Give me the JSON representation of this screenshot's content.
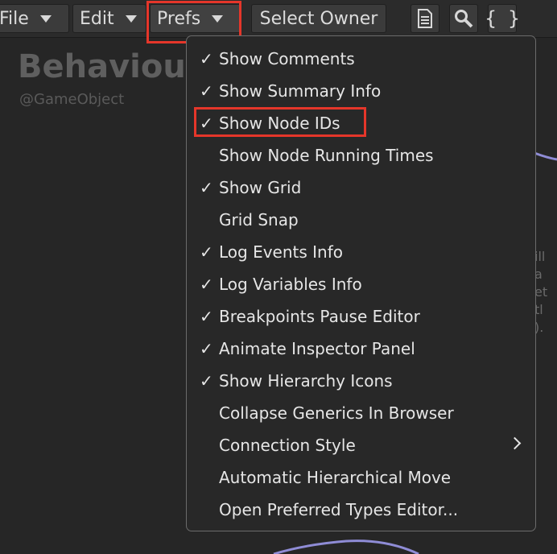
{
  "toolbar": {
    "file_label": "File",
    "edit_label": "Edit",
    "prefs_label": "Prefs",
    "select_owner_label": "Select Owner",
    "doc_icon": "document-icon",
    "search_icon": "magnifier-icon",
    "braces_label": "{ }"
  },
  "canvas": {
    "title": "Behaviour",
    "subtitle": "@GameObject",
    "node_text_lines": [
      "ill a",
      "et tl",
      ")."
    ]
  },
  "menu": {
    "items": [
      {
        "label": "Show Comments",
        "checked": true
      },
      {
        "label": "Show Summary Info",
        "checked": true
      },
      {
        "label": "Show Node IDs",
        "checked": true
      },
      {
        "label": "Show Node Running Times",
        "checked": false
      },
      {
        "label": "Show Grid",
        "checked": true
      },
      {
        "label": "Grid Snap",
        "checked": false
      },
      {
        "label": "Log Events Info",
        "checked": true
      },
      {
        "label": "Log Variables Info",
        "checked": true
      },
      {
        "label": "Breakpoints Pause Editor",
        "checked": true
      },
      {
        "label": "Animate Inspector Panel",
        "checked": true
      },
      {
        "label": "Show Hierarchy Icons",
        "checked": true
      },
      {
        "label": "Collapse Generics In Browser",
        "checked": false
      },
      {
        "label": "Connection Style",
        "checked": false,
        "submenu": true
      },
      {
        "label": "Automatic Hierarchical Move",
        "checked": false
      },
      {
        "label": "Open Preferred Types Editor...",
        "checked": false
      }
    ],
    "check_glyph": "✓"
  },
  "colors": {
    "highlight": "#e5362a",
    "wire": "#8f8cd6"
  }
}
